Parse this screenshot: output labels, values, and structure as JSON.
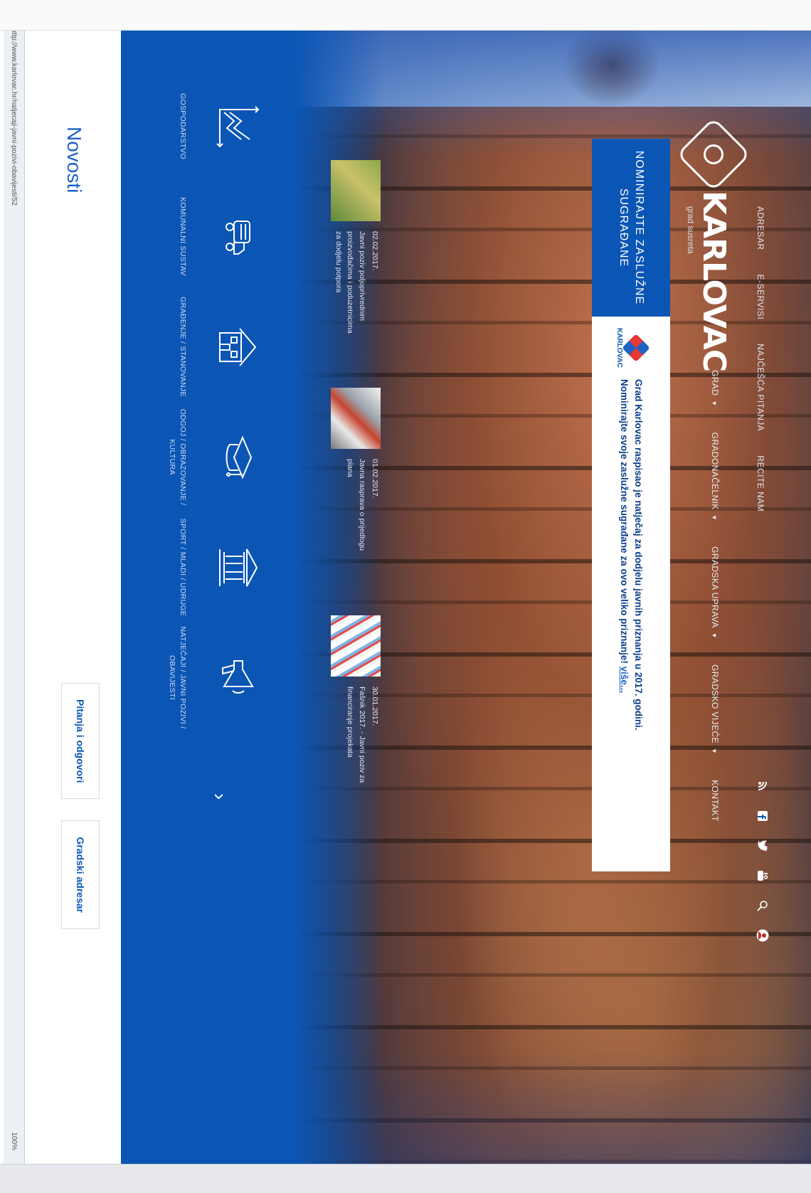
{
  "top_nav": [
    "ADRESAR",
    "E-SERVISI",
    "NAJČEŠĆA PITANJA",
    "RECITE NAM"
  ],
  "social_icons": [
    "rss-icon",
    "facebook-icon",
    "twitter-icon",
    "youtube-icon",
    "search-icon",
    "user-icon"
  ],
  "logo": {
    "title": "KARLOVAC",
    "subtitle": "grad susreta"
  },
  "main_nav": [
    {
      "label": "GRAD"
    },
    {
      "label": "GRADONAČELNIK"
    },
    {
      "label": "GRADSKA UPRAVA"
    },
    {
      "label": "GRADSKO VIJEĆE"
    },
    {
      "label": "KONTAKT"
    }
  ],
  "banner": {
    "title_line1": "NOMINIRAJTE ZASLUŽNE",
    "title_line2": "SUGRAĐANE",
    "logo_text": "KARLOVAC",
    "text_line1": "Grad Karlovac raspisao je natječaj za dodjelu javnih priznanja u 2017. godini.",
    "text_line2": "Nominirajte svoje zaslužne sugrađane za ovo veliko priznanje!",
    "more": "više..."
  },
  "news": [
    {
      "date": "02.02.2017.",
      "text": "Javni poziv poljoprivrednim proizvođačima i poduzetnicima za dodjelu potpora"
    },
    {
      "date": "01.02.2017.",
      "text": "Javna rasprava o prijedlogu plana"
    },
    {
      "date": "30.01.2017.",
      "text": "Fašnik 2017. - Javni poziv za financiranje projekata"
    }
  ],
  "categories": [
    {
      "label": "GOSPODARSTVO",
      "icon": "chart-icon"
    },
    {
      "label": "KOMUNALNI SUSTAV",
      "icon": "truck-icon"
    },
    {
      "label": "GRAĐENJE / STANOVANJE",
      "icon": "building-icon"
    },
    {
      "label": "ODGOJ / OBRAZOVANJE / KULTURA",
      "icon": "graduation-cap-icon"
    },
    {
      "label": "SPORT / MLADI / UDRUGE",
      "icon": "institution-icon"
    },
    {
      "label": "NATJEČAJI / JAVNI POZIVI / OBAVIJESTI",
      "icon": "megaphone-icon"
    }
  ],
  "sections": {
    "news_title": "Novosti"
  },
  "buttons": {
    "faq": "Pitanja i odgovori",
    "directory": "Gradski adresar"
  },
  "statusbar": {
    "url": "http://www.karlovac.hr/natjecaji-javni-pozivi-obavijesti/52",
    "zoom": "100%"
  },
  "colors": {
    "brand_blue": "#0b56b5",
    "link_blue": "#1e63c6"
  }
}
